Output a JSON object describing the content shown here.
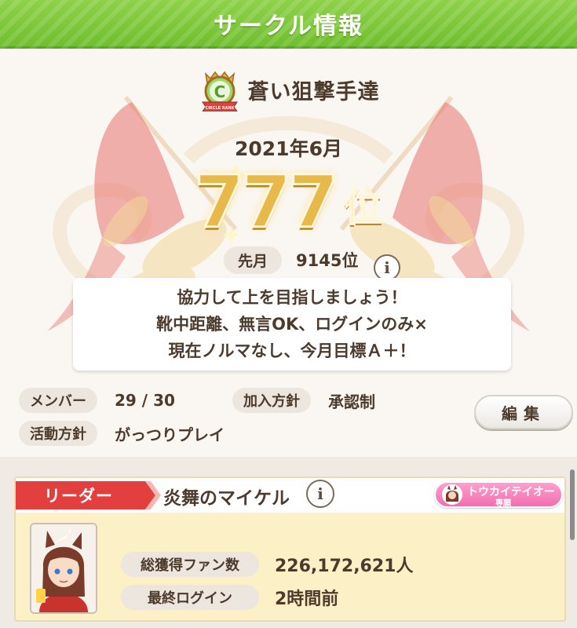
{
  "header": {
    "title": "サークル情報"
  },
  "circle": {
    "rank_badge_letter": "C",
    "rank_badge_caption": "CIRCLE RANK",
    "name": "蒼い狙撃手達",
    "month": "2021年6月",
    "rank_number": "777",
    "rank_suffix": "位",
    "prev_label": "先月",
    "prev_value": "9145位",
    "description": [
      "協力して上を目指しましょう！",
      "靴中距離、無言OK、ログインのみ×",
      "現在ノルマなし、今月目標Ａ＋！"
    ],
    "members_label": "メンバー",
    "members_value": "29 / 30",
    "join_policy_label": "加入方針",
    "join_policy_value": "承認制",
    "activity_label": "活動方針",
    "activity_value": "がっつりプレイ",
    "edit_label": "編集"
  },
  "leader": {
    "tag": "リーダー",
    "name": "炎舞のマイケル",
    "uma_name": "トウカイテイオー",
    "uma_sub": "専願",
    "fans_label": "総獲得ファン数",
    "fans_value": "226,172,621人",
    "login_label": "最終ログイン",
    "login_value": "2時間前"
  },
  "icons": {
    "info": "info-icon",
    "rank_badge": "circle-rank-badge-icon"
  },
  "colors": {
    "header_green": "#6fbf2e",
    "gold": "#e6b94a",
    "leader_red": "#e33f3f",
    "card_yellow": "#fcf0c6",
    "uma_pink": "#ef6fae"
  }
}
